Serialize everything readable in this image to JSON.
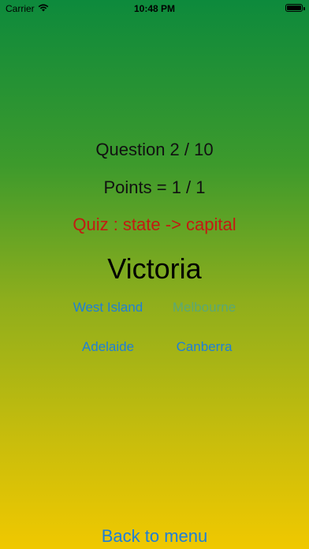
{
  "status_bar": {
    "carrier": "Carrier",
    "time": "10:48 PM",
    "icons": [
      "wifi-icon",
      "battery-icon"
    ]
  },
  "quiz": {
    "question": "Question 2 / 10",
    "points": "Points = 1 / 1",
    "mode": "Quiz : state -> capital",
    "prompt": "Victoria",
    "answers": [
      {
        "label": "West Island",
        "enabled": true
      },
      {
        "label": "Melbourne",
        "enabled": false
      },
      {
        "label": "Adelaide",
        "enabled": true
      },
      {
        "label": "Canberra",
        "enabled": true
      }
    ]
  },
  "footer": {
    "back_label": "Back to menu"
  },
  "colors": {
    "gradient_top": "#0d8a3c",
    "gradient_bottom": "#f0c800",
    "link": "#1e7fd8",
    "mode_text": "#c41a12"
  }
}
